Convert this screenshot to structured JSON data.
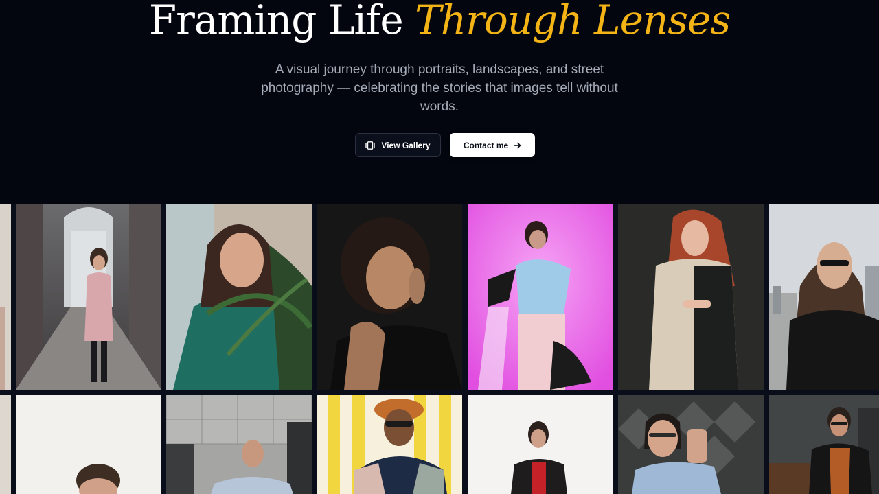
{
  "hero": {
    "headline_main": "Framing Life",
    "headline_accent": "Through Lenses",
    "subtitle": "A visual journey through portraits, landscapes, and street photography — celebrating the stories that images tell without words.",
    "accent_color": "#f4b416",
    "background_color": "#03060f"
  },
  "actions": {
    "view_gallery": {
      "label": "View Gallery",
      "icon": "gallery-icon"
    },
    "contact": {
      "label": "Contact me",
      "icon": "arrow-right-icon"
    }
  },
  "gallery": {
    "row_1": [
      "portrait-partial-left",
      "woman-pink-coat-arcade",
      "woman-green-blouse-plants",
      "curly-hair-woman-dark",
      "woman-pink-backdrop",
      "redhead-trench-coat",
      "woman-sunglasses-city"
    ],
    "row_2": [
      "portrait-partial-left",
      "man-white-background",
      "man-concrete-wall",
      "man-bucket-hat-stripes",
      "man-red-sweater",
      "man-glasses-pattern-wall",
      "man-suit-terrace"
    ]
  }
}
